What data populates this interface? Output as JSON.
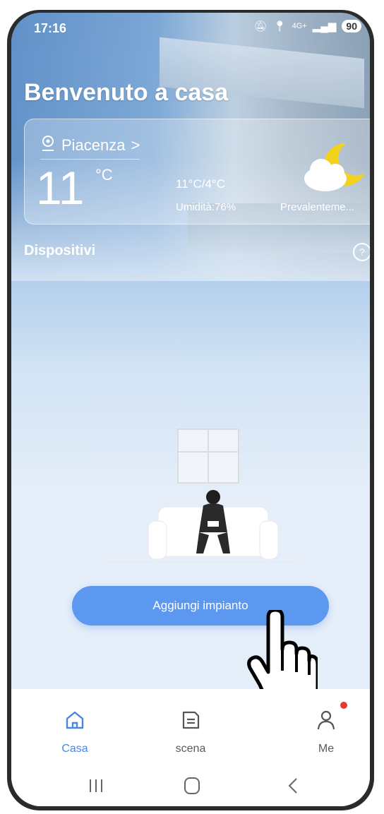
{
  "status_bar": {
    "time": "17:16",
    "network": "4G+",
    "battery": "90"
  },
  "header": {
    "title": "Benvenuto a casa"
  },
  "weather": {
    "city": "Piacenza",
    "temperature": "11",
    "unit": "°C",
    "range": "11°C/4°C",
    "humidity": "Umidità:76%",
    "condition": "Prevalenteme..."
  },
  "devices": {
    "title": "Dispositivi",
    "help": "?"
  },
  "add_button": {
    "label": "Aggiungi impianto"
  },
  "tabs": [
    {
      "label": "Casa",
      "icon": "home-icon",
      "active": true
    },
    {
      "label": "scena",
      "icon": "scene-icon",
      "active": false
    },
    {
      "label": "Me",
      "icon": "person-icon",
      "active": false,
      "badge": true
    }
  ],
  "colors": {
    "accent": "#4a86e8",
    "button": "#5c97f0",
    "badge": "#e53935"
  }
}
